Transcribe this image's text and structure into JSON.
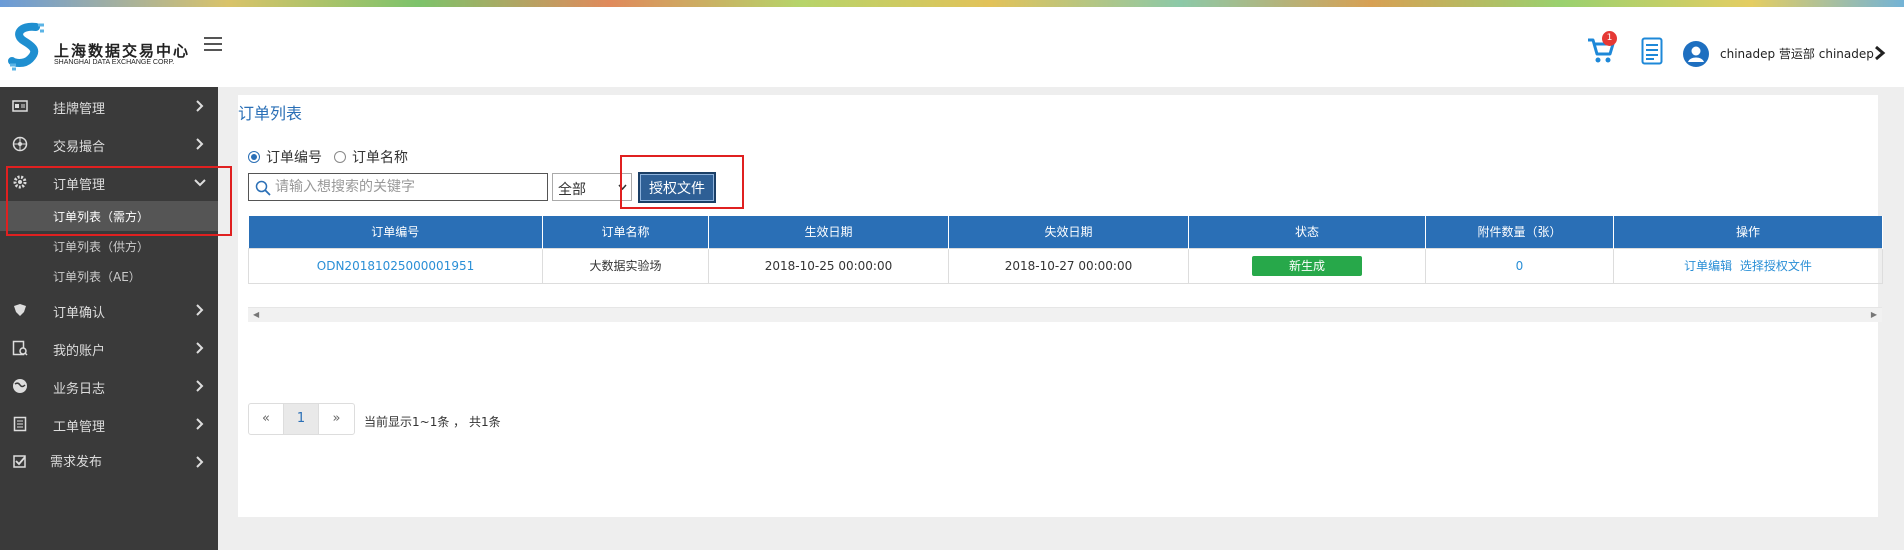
{
  "header": {
    "logo_cn": "上海数据交易中心",
    "logo_en": "SHANGHAI DATA EXCHANGE CORP.",
    "cart_count": "1",
    "user": "chinadep 营运部 chinadep"
  },
  "sidebar": {
    "items": [
      {
        "label": "挂牌管理",
        "icon": "card-icon"
      },
      {
        "label": "交易撮合",
        "icon": "network-icon"
      },
      {
        "label": "订单管理",
        "icon": "gear-icon"
      },
      {
        "label": "订单确认",
        "icon": "shield-icon"
      },
      {
        "label": "我的账户",
        "icon": "account-icon"
      },
      {
        "label": "业务日志",
        "icon": "globe-icon"
      },
      {
        "label": "工单管理",
        "icon": "document-icon"
      },
      {
        "label": "需求发布",
        "icon": "checkbox-icon"
      }
    ],
    "subitems": [
      "订单列表（需方）",
      "订单列表（供方）",
      "订单列表（AE）"
    ]
  },
  "main": {
    "title": "订单列表",
    "radio_order_no": "订单编号",
    "radio_order_name": "订单名称",
    "search_placeholder": "请输入想搜索的关键字",
    "select_value": "全部",
    "auth_button": "授权文件",
    "table": {
      "headers": [
        "订单编号",
        "订单名称",
        "生效日期",
        "失效日期",
        "状态",
        "附件数量（张）",
        "操作"
      ],
      "rows": [
        {
          "order_no": "ODN20181025000001951",
          "order_name": "大数据实验场",
          "start": "2018-10-25 00:00:00",
          "end": "2018-10-27 00:00:00",
          "status": "新生成",
          "attachments": "0",
          "action_edit": "订单编辑",
          "action_select": "选择授权文件"
        }
      ]
    },
    "pager": {
      "prev": "«",
      "current": "1",
      "next": "»",
      "info": "当前显示1~1条 ， 共1条"
    }
  },
  "colors": {
    "primary": "#2a6fb6",
    "status_green": "#27a84a",
    "highlight": "#e02020",
    "sidebar": "#3a3a3a"
  }
}
